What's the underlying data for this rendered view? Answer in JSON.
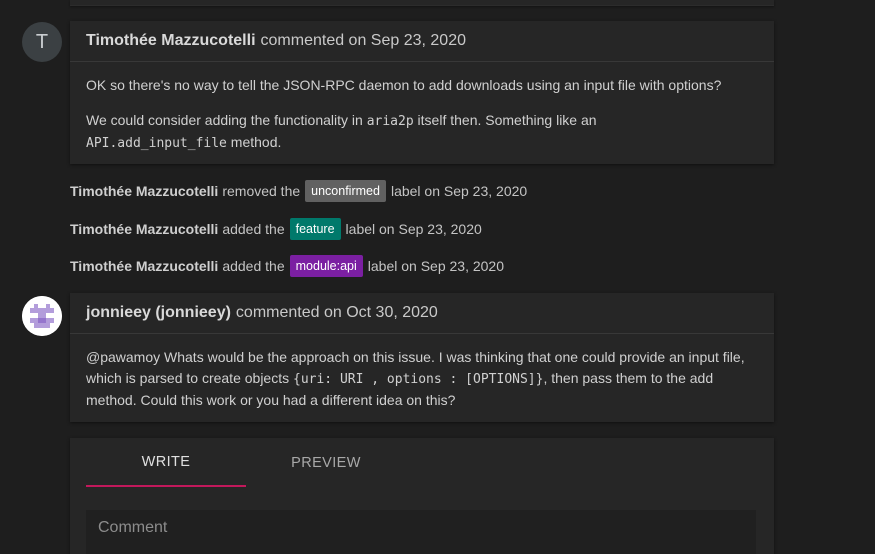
{
  "comments": [
    {
      "avatar_letter": "T",
      "author": "Timothée Mazzucotelli",
      "action": "commented on Sep 23, 2020",
      "paragraph1": "OK so there's no way to tell the JSON-RPC daemon to add downloads using an input file with options?",
      "paragraph2_before": "We could consider adding the functionality in ",
      "paragraph2_code1": "aria2p",
      "paragraph2_middle": " itself then. Something like an",
      "paragraph2_code2": "API.add_input_file",
      "paragraph2_after": " method."
    },
    {
      "author": "jonnieey (jonnieey)",
      "action": "commented on Oct 30, 2020",
      "body_before": "@pawamoy Whats would be the approach on this issue. I was thinking that one could provide an input file, which is parsed to create objects ",
      "body_code": "{uri: URI , options : [OPTIONS]}",
      "body_after": ", then pass them to the add method. Could this work or you had a different idea on this?"
    }
  ],
  "events": [
    {
      "author": "Timothée Mazzucotelli",
      "verb": "removed the",
      "label": "unconfirmed",
      "label_color": "#616161",
      "suffix": "label on Sep 23, 2020"
    },
    {
      "author": "Timothée Mazzucotelli",
      "verb": "added the",
      "label": "feature",
      "label_color": "#00796b",
      "suffix": "label on Sep 23, 2020"
    },
    {
      "author": "Timothée Mazzucotelli",
      "verb": "added the",
      "label": "module:api",
      "label_color": "#7b1fa2",
      "suffix": "label on Sep 23, 2020"
    }
  ],
  "editor": {
    "tabs": [
      "WRITE",
      "PREVIEW"
    ],
    "active_tab": "WRITE",
    "placeholder": "Comment",
    "accent_color": "#c2185b"
  },
  "identicon_color": "#b39ddb"
}
